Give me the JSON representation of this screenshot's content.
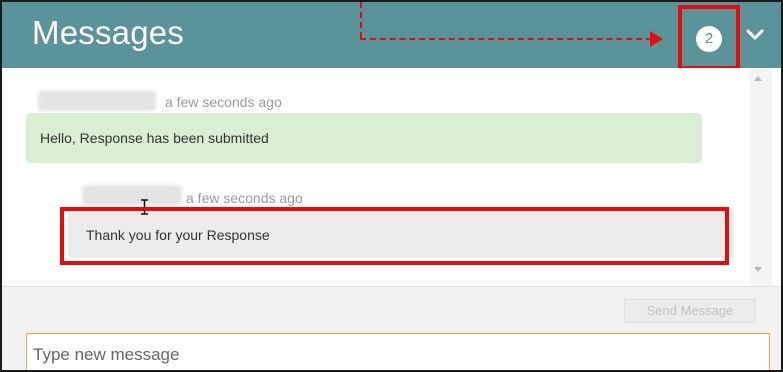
{
  "header": {
    "title": "Messages",
    "unread_count": "2",
    "expand_icon": "chevron-down-icon"
  },
  "messages": [
    {
      "sender": "",
      "timestamp": "a few seconds ago",
      "text": "Hello, Response has been submitted",
      "type": "received"
    },
    {
      "sender": "",
      "timestamp": "a few seconds ago",
      "text": "Thank you for your Response",
      "type": "sent"
    }
  ],
  "composer": {
    "send_label": "Send Message",
    "placeholder": "Type new message"
  },
  "colors": {
    "header_bg": "#5b939a",
    "received_bubble": "#daeed4",
    "sent_bubble": "#ececec",
    "annotation": "#e30d0d",
    "input_border": "#f0a24a"
  }
}
